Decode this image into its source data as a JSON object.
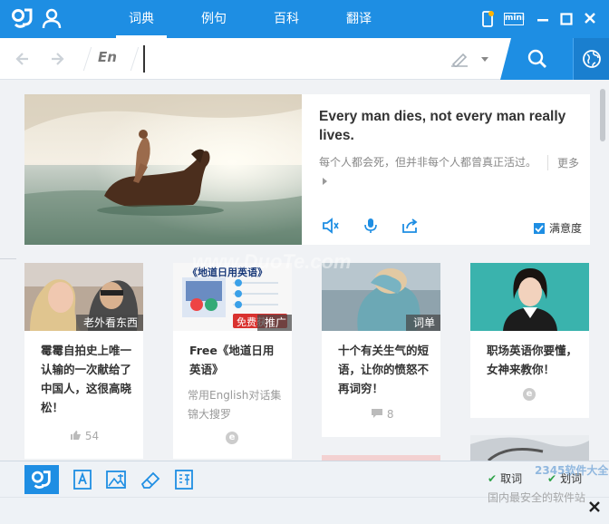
{
  "titlebar": {
    "tabs": [
      {
        "label": "词典",
        "active": true
      },
      {
        "label": "例句",
        "active": false
      },
      {
        "label": "百科",
        "active": false
      },
      {
        "label": "翻译",
        "active": false
      }
    ],
    "mini_label": "mini",
    "accent_color": "#1e8ee3"
  },
  "search": {
    "lang": "En",
    "value": "",
    "placeholder": ""
  },
  "feature": {
    "quote_en": "Every man dies, not every man really lives.",
    "quote_zh": "每个人都会死，但并非每个人都曾真正活过。",
    "more": "更多",
    "satisfy": "满意度"
  },
  "cards": [
    {
      "tag": "老外看东西",
      "title": "霉霉自拍史上唯一认输的一次献给了中国人，这很高晓松！",
      "likes": "54"
    },
    {
      "tag": "推广",
      "tag_prefix": "免费获",
      "banner": "《地道日用英语》",
      "title": "Free《地道日用英语》",
      "sub": "常用English对话集锦大搜罗"
    },
    {
      "tag": "词单",
      "title": "十个有关生气的短语，让你的愤怒不再词穷！",
      "comments": "8"
    },
    {
      "title": "职场英语你要懂，女神来教你！"
    }
  ],
  "bottom": {
    "options": [
      {
        "label": "取词",
        "checked": true
      },
      {
        "label": "划词",
        "checked": true
      }
    ]
  },
  "watermarks": {
    "center": "www.DuoTe.com",
    "site_top": "2345软件大全",
    "site_bottom": "国内最安全的软件站"
  }
}
